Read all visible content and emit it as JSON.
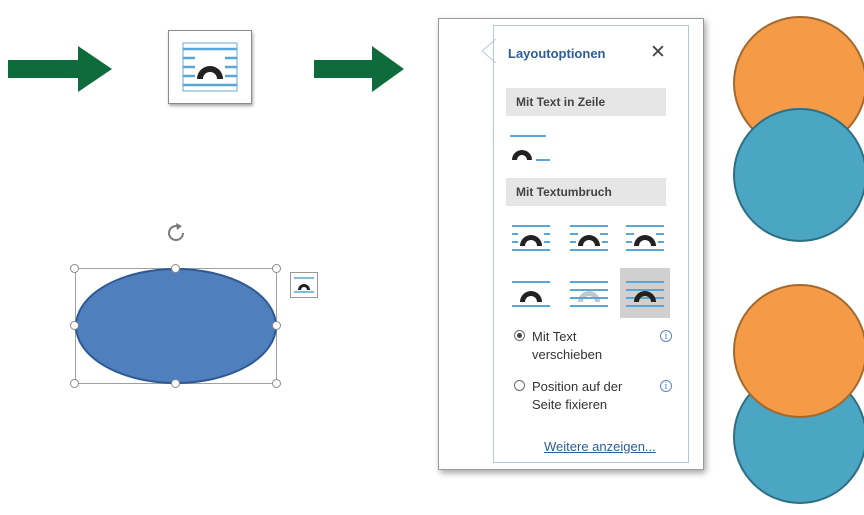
{
  "panel": {
    "title": "Layoutoptionen",
    "close_glyph": "✕",
    "section_inline": "Mit Text in Zeile",
    "section_wrap": "Mit Textumbruch",
    "radio_move": "Mit Text verschieben",
    "radio_fix": "Position auf der Seite fixieren",
    "more_link": "Weitere anzeigen...",
    "info_glyph": "i"
  },
  "colors": {
    "arrow_green": "#0e6b3b",
    "accent_blue": "#2e5c99",
    "ellipse_fill": "#4f7fbd",
    "circle_orange": "#f59a46",
    "circle_teal": "#4aa6c2"
  },
  "icons": {
    "arrow": "right-arrow-icon",
    "layout": "layout-options-icon",
    "rotate": "rotate-icon",
    "info": "info-icon"
  }
}
